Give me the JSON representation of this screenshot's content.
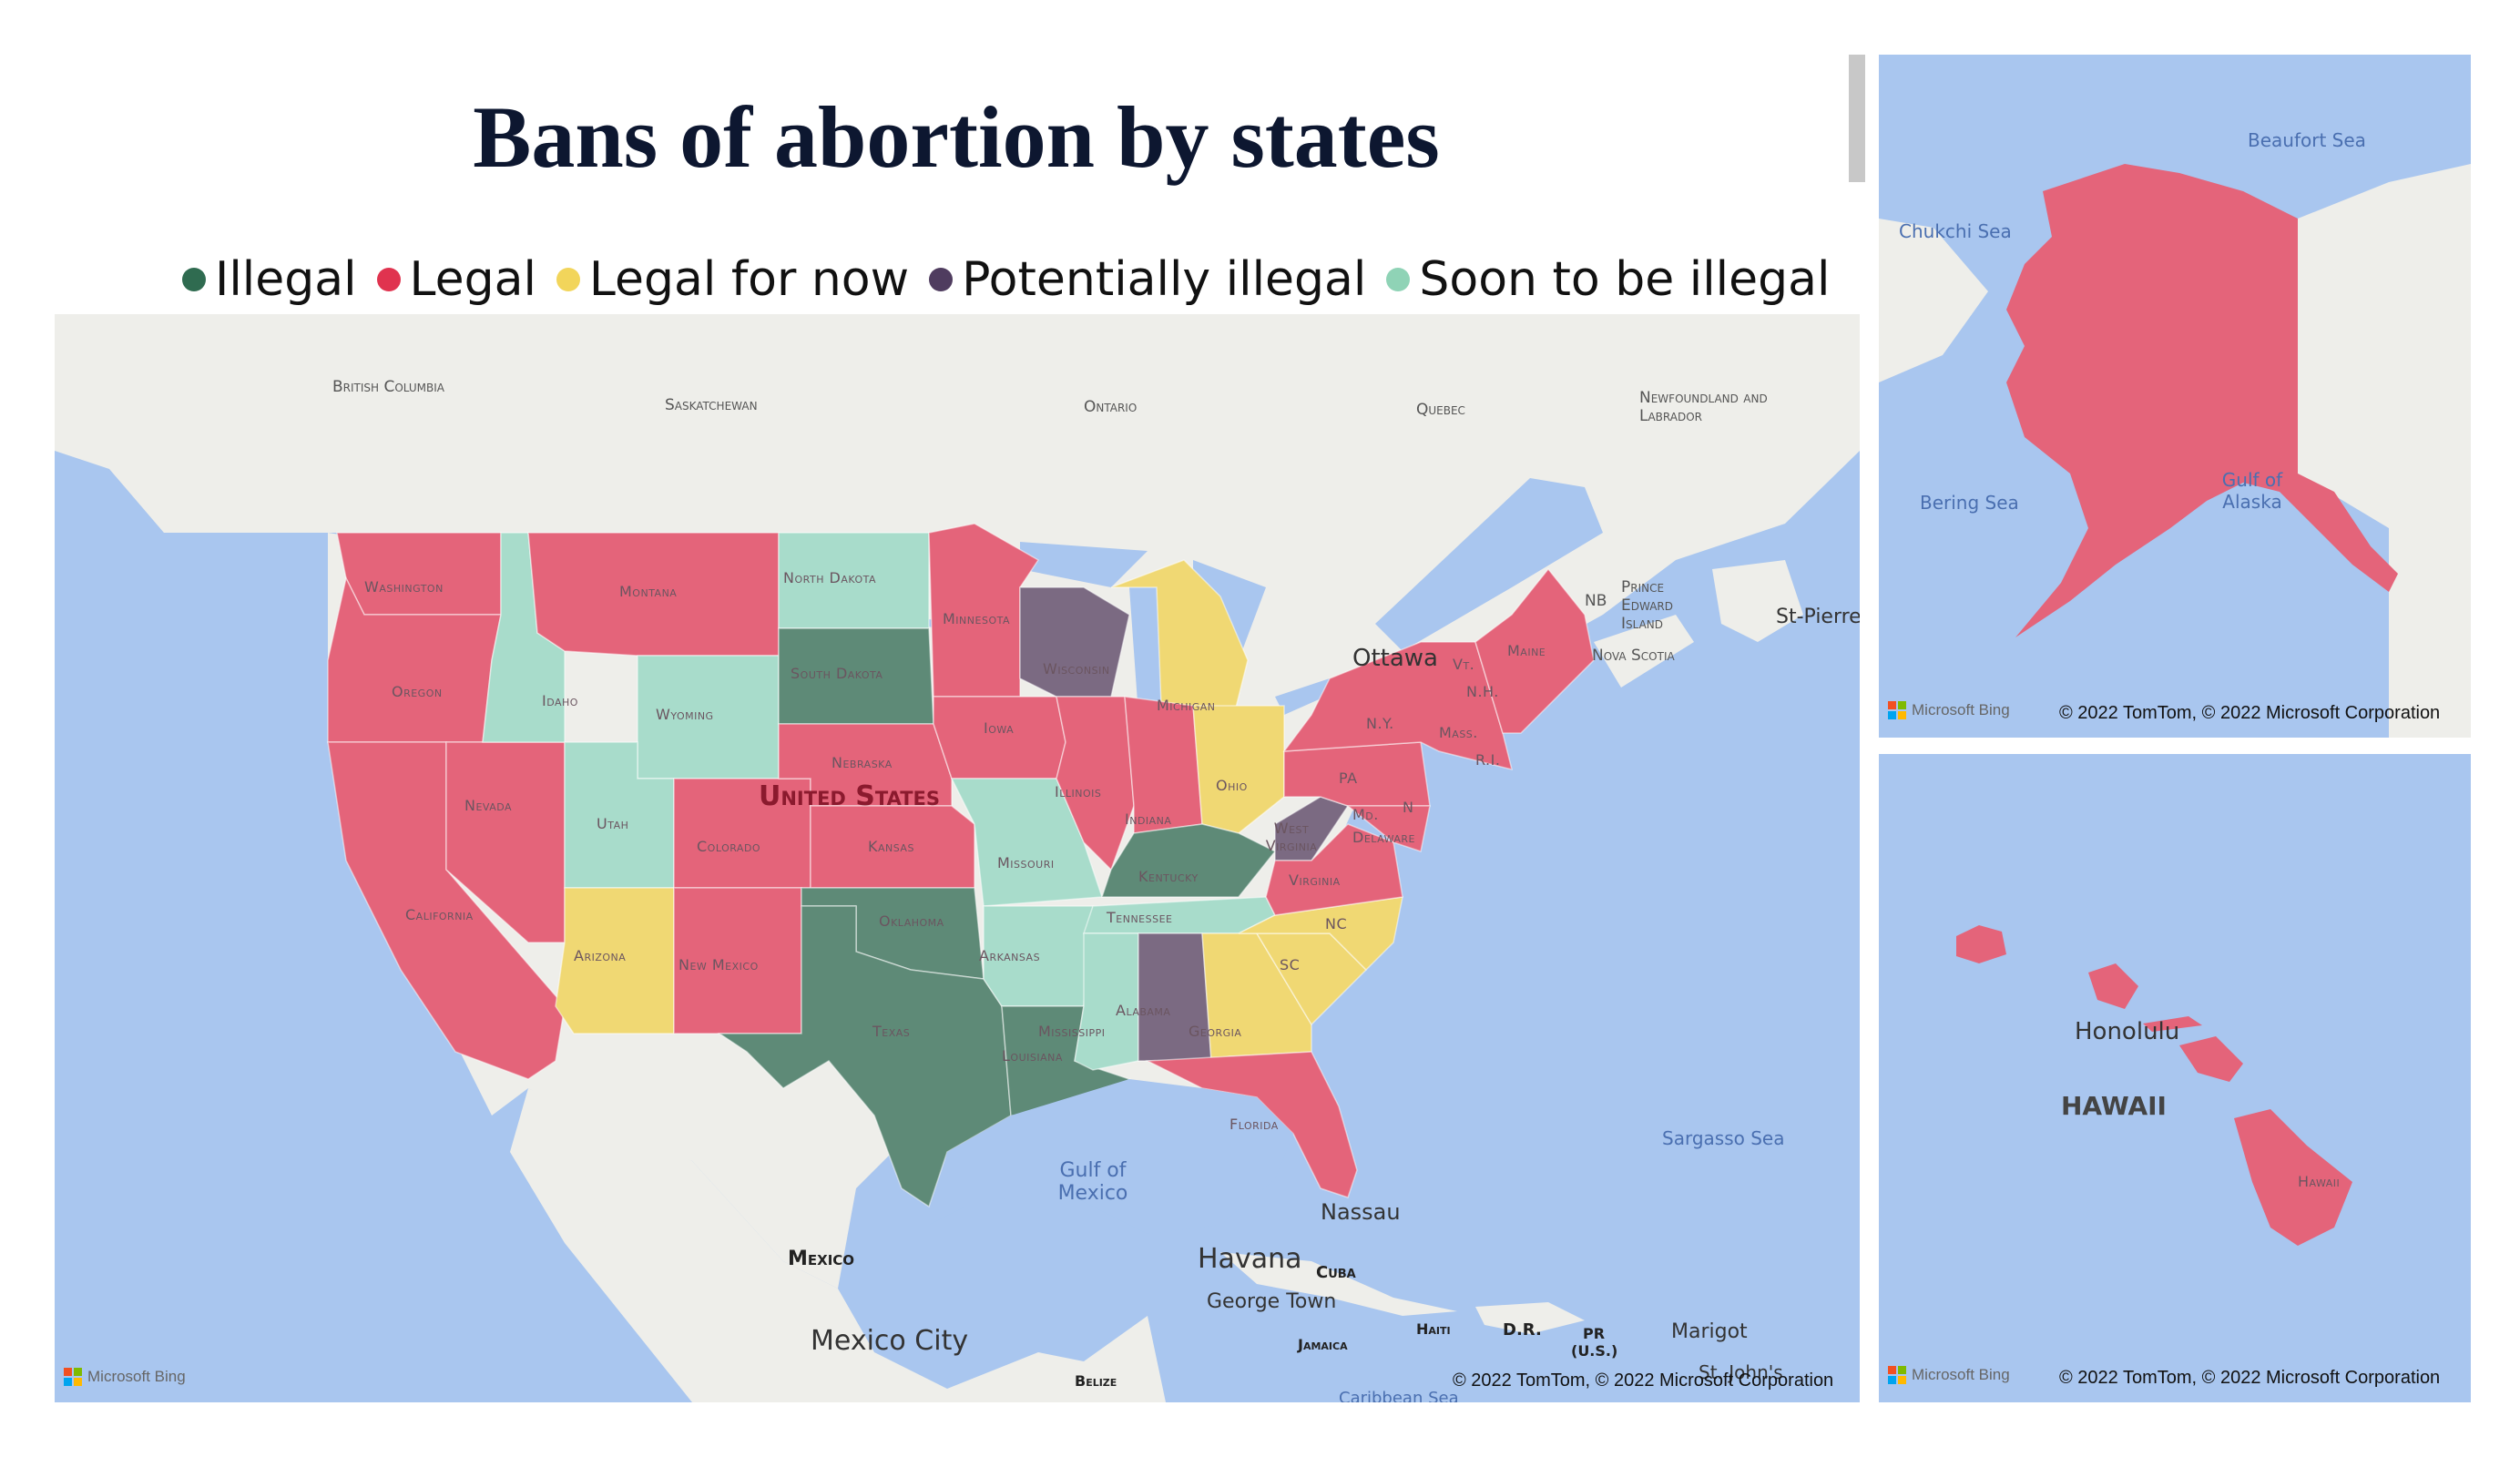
{
  "title": "Bans of abortion by states",
  "legend": [
    {
      "label": "Illegal",
      "color": "#2f6b50"
    },
    {
      "label": "Legal",
      "color": "#e0334f"
    },
    {
      "label": "Legal for now",
      "color": "#f2d55b"
    },
    {
      "label": "Potentially illegal",
      "color": "#4f3c5f"
    },
    {
      "label": "Soon to be illegal",
      "color": "#8fd3b6"
    }
  ],
  "colors": {
    "illegal": "#5e8a77",
    "legal": "#e4647a",
    "legal_for_now": "#f0d873",
    "potentially_illegal": "#7b6a82",
    "soon_to_be_illegal": "#a8dccb",
    "water": "#a9c6ef",
    "land": "#eeeeea"
  },
  "states": {
    "illegal": [
      "South Dakota",
      "Texas",
      "Oklahoma",
      "Louisiana",
      "Kentucky"
    ],
    "legal": [
      "Washington",
      "Oregon",
      "California",
      "Nevada",
      "Montana",
      "Minnesota",
      "Iowa",
      "Illinois",
      "Nebraska",
      "Kansas",
      "Colorado",
      "New Mexico",
      "Indiana",
      "Virginia",
      "Pennsylvania",
      "New York",
      "Maine",
      "Florida",
      "Alaska",
      "Hawaii"
    ],
    "legal_for_now": [
      "Arizona",
      "Michigan",
      "Ohio",
      "North Carolina",
      "South Carolina",
      "Georgia"
    ],
    "potentially_illegal": [
      "Wisconsin",
      "West Virginia",
      "Alabama"
    ],
    "soon_to_be_illegal": [
      "Idaho",
      "Wyoming",
      "Utah",
      "North Dakota",
      "Missouri",
      "Arkansas",
      "Tennessee",
      "Mississippi"
    ]
  },
  "main_map": {
    "state_labels": [
      "Washington",
      "Oregon",
      "California",
      "Nevada",
      "Montana",
      "Idaho",
      "Wyoming",
      "Utah",
      "Arizona",
      "Colorado",
      "New Mexico",
      "North Dakota",
      "South Dakota",
      "Nebraska",
      "Kansas",
      "Oklahoma",
      "Texas",
      "Minnesota",
      "Iowa",
      "Missouri",
      "Arkansas",
      "Louisiana",
      "Wisconsin",
      "Illinois",
      "Michigan",
      "Indiana",
      "Ohio",
      "Kentucky",
      "Tennessee",
      "Mississippi",
      "Alabama",
      "Georgia",
      "Florida",
      "SC",
      "NC",
      "Virginia",
      "West Virginia",
      "PA",
      "N.Y.",
      "Maine",
      "Vt.",
      "N.H.",
      "Mass.",
      "R.I.",
      "Md.",
      "N",
      "Delaware"
    ],
    "country_label": "United States",
    "region_labels": [
      "British Columbia",
      "Saskatchewan",
      "Ontario",
      "Quebec",
      "Newfoundland and Labrador",
      "NB",
      "Prince Edward Island",
      "Nova Scotia",
      "Mexico",
      "Cuba",
      "Jamaica",
      "Haiti",
      "D.R.",
      "PR (U.S.)",
      "Belize"
    ],
    "places": [
      "Ottawa",
      "St-Pierre",
      "Nassau",
      "Havana",
      "George Town",
      "Mexico City",
      "Marigot",
      "St. John's"
    ],
    "seas": [
      "Gulf of Mexico",
      "Sargasso Sea",
      "Caribbean Sea"
    ],
    "attribution": "Microsoft Bing",
    "copyright": "© 2022 TomTom, © 2022 Microsoft Corporation"
  },
  "alaska_map": {
    "seas": [
      "Beaufort Sea",
      "Chukchi Sea",
      "Bering Sea",
      "Gulf of Alaska"
    ],
    "attribution": "Microsoft Bing",
    "copyright": "© 2022 TomTom, © 2022 Microsoft Corporation"
  },
  "hawaii_map": {
    "labels": [
      "Honolulu",
      "HAWAII",
      "Hawaii"
    ],
    "attribution": "Microsoft Bing",
    "copyright": "© 2022 TomTom, © 2022 Microsoft Corporation"
  }
}
